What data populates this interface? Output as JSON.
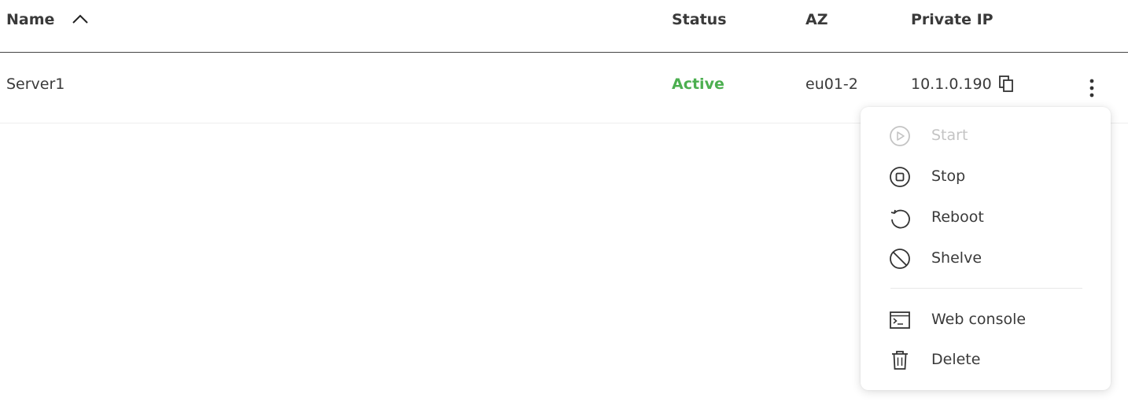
{
  "table": {
    "columns": {
      "name": "Name",
      "status": "Status",
      "az": "AZ",
      "private_ip": "Private IP"
    },
    "sort_icon": "chevron-up-icon",
    "rows": [
      {
        "name": "Server1",
        "status": "Active",
        "az": "eu01-2",
        "private_ip": "10.1.0.190",
        "copy_icon": "copy-icon",
        "actions_icon": "kebab-menu-icon"
      }
    ]
  },
  "colors": {
    "status_active": "#4caf50",
    "text": "#3a3a3a",
    "disabled_text": "#c4c4c4"
  },
  "action_menu": {
    "items": [
      {
        "label": "Start",
        "icon": "play-circle-icon",
        "disabled": true
      },
      {
        "label": "Stop",
        "icon": "stop-circle-icon",
        "disabled": false
      },
      {
        "label": "Reboot",
        "icon": "reboot-icon",
        "disabled": false
      },
      {
        "label": "Shelve",
        "icon": "ban-circle-icon",
        "disabled": false
      },
      {
        "label": "Web console",
        "icon": "terminal-icon",
        "disabled": false
      },
      {
        "label": "Delete",
        "icon": "trash-icon",
        "disabled": false
      }
    ]
  }
}
